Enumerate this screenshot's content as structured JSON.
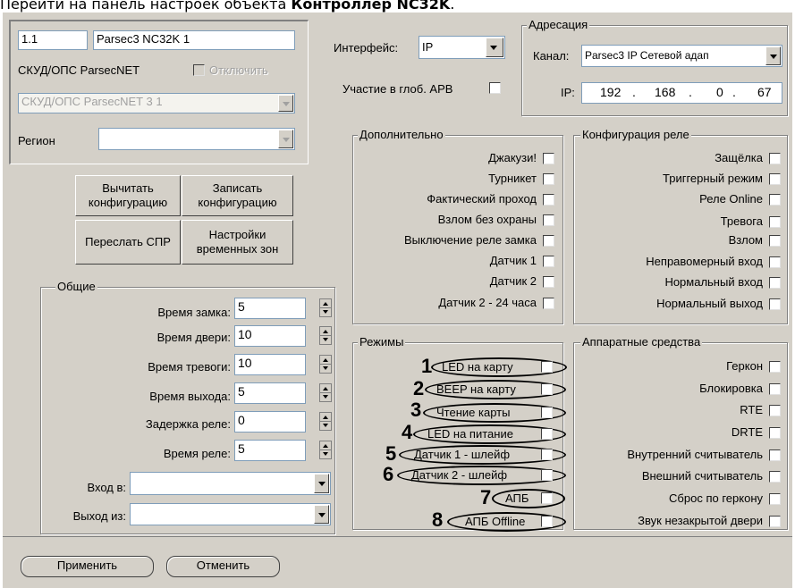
{
  "doc_title_prefix": "Перейти на панель настроек объекта ",
  "doc_title_bold": "Контроллер NC32K",
  "object": {
    "id": "1.1",
    "name": "Parsec3 NC32K 1",
    "type_label": "СКУД/ОПС ParsecNET",
    "disable_label": "Отключить",
    "parent_value": "СКУД/ОПС ParsecNET 3 1",
    "region_label": "Регион",
    "region_value": ""
  },
  "interface": {
    "label": "Интерфейс:",
    "value": "IP"
  },
  "global_apb": {
    "label": "Участие в глоб. АРВ"
  },
  "addressing": {
    "title": "Адресация",
    "channel_label": "Канал:",
    "channel_value": "Parsec3 IP Сетевой адап",
    "ip_label": "IP:",
    "ip": [
      "192",
      "168",
      "0",
      "67"
    ]
  },
  "buttons": {
    "read_config": [
      "Вычитать",
      "конфигурацию"
    ],
    "write_config": [
      "Записать",
      "конфигурацию"
    ],
    "send_spr": "Переслать СПР",
    "time_zones": [
      "Настройки",
      "временных зон"
    ]
  },
  "general": {
    "title": "Общие",
    "fields": [
      {
        "label": "Время замка:",
        "value": "5"
      },
      {
        "label": "Время двери:",
        "value": "10"
      },
      {
        "label": "Время тревоги:",
        "value": "10"
      },
      {
        "label": "Время выхода:",
        "value": "5"
      },
      {
        "label": "Задержка реле:",
        "value": "0"
      },
      {
        "label": "Время реле:",
        "value": "5"
      }
    ],
    "entry_label": "Вход в:",
    "exit_label": "Выход из:"
  },
  "extra": {
    "title": "Дополнительно",
    "items": [
      "Джакузи!",
      "Турникет",
      "Фактический проход",
      "Взлом без охраны",
      "Выключение реле замка",
      "Датчик 1",
      "Датчик 2",
      "Датчик 2 - 24 часа"
    ]
  },
  "relay": {
    "title": "Конфигурация реле",
    "items": [
      "Защёлка",
      "Триггерный режим",
      "Реле Online",
      "Тревога",
      "Взлом",
      "Неправомерный вход",
      "Нормальный вход",
      "Нормальный выход"
    ]
  },
  "modes": {
    "title": "Режимы",
    "items": [
      {
        "num": "1",
        "label": "LED на карту"
      },
      {
        "num": "2",
        "label": "BEEP на карту"
      },
      {
        "num": "3",
        "label": "Чтение карты"
      },
      {
        "num": "4",
        "label": "LED на питание"
      },
      {
        "num": "5",
        "label": "Датчик 1 - шлейф"
      },
      {
        "num": "6",
        "label": "Датчик 2 - шлейф"
      },
      {
        "num": "7",
        "label": "АПБ"
      },
      {
        "num": "8",
        "label": "АПБ Offline"
      }
    ]
  },
  "hardware": {
    "title": "Аппаратные средства",
    "items": [
      "Геркон",
      "Блокировка",
      "RTE",
      "DRTE",
      "Внутренний считыватель",
      "Внешний считыватель",
      "Сброс по геркону",
      "Звук незакрытой двери"
    ]
  },
  "footer": {
    "apply": "Применить",
    "cancel": "Отменить"
  }
}
